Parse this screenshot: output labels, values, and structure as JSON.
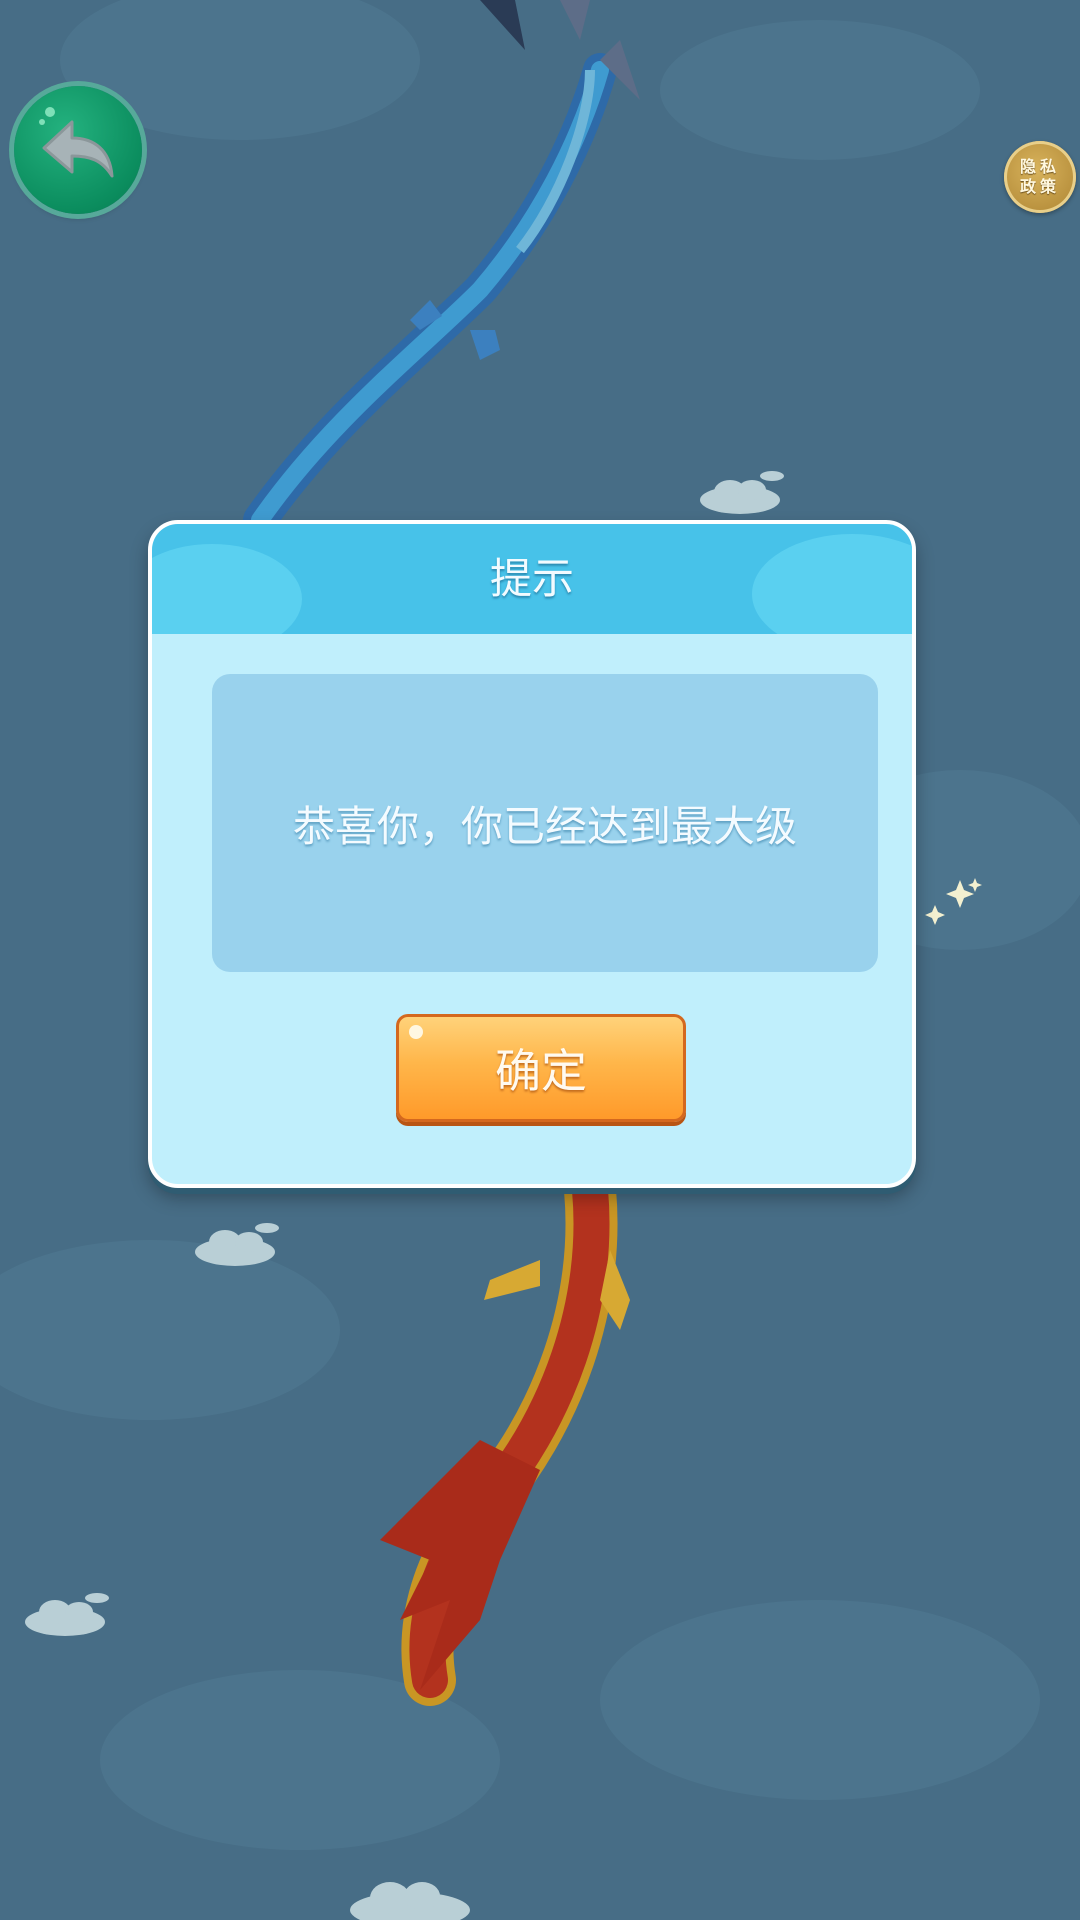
{
  "background": {
    "sky_color": "#476d86"
  },
  "top_controls": {
    "back_icon": "undo-arrow-icon",
    "privacy_label_line1": "隐私",
    "privacy_label_line2": "政策"
  },
  "dialog": {
    "title": "提示",
    "message": "恭喜你，你已经达到最大级",
    "confirm_label": "确定"
  },
  "colors": {
    "dialog_body": "#c0effc",
    "dialog_header": "#47c2e9",
    "confirm_button": "#ffb64a",
    "back_button": "#0b8d5e",
    "privacy_badge": "#b78f3c"
  }
}
